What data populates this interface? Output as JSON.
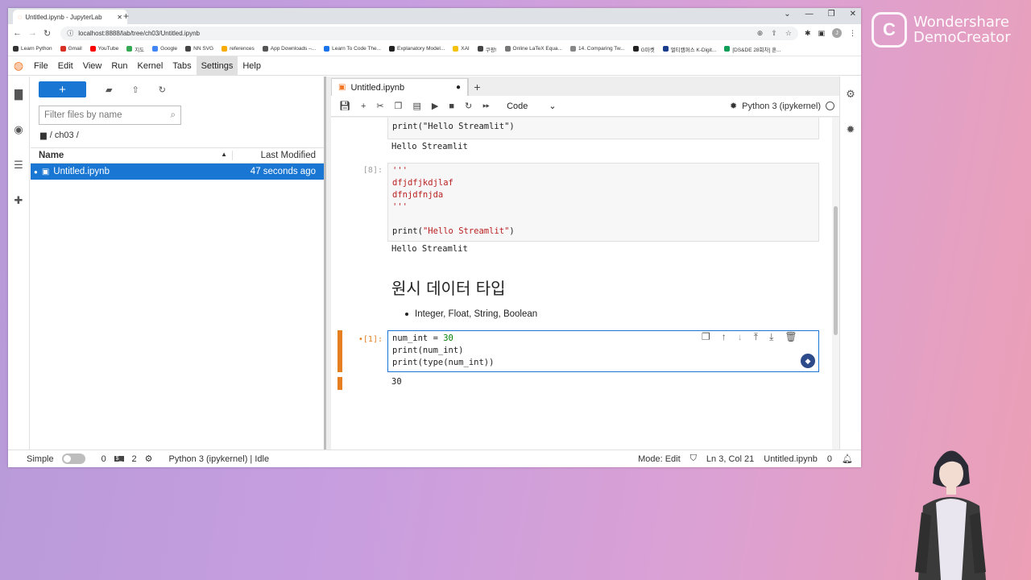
{
  "browser": {
    "tab_title": "Untitled.ipynb - JupyterLab",
    "url": "localhost:8888/lab/tree/ch03/Untitled.ipynb",
    "profile_initial": "J",
    "bookmarks": [
      {
        "label": "Learn Python",
        "color": "#333333"
      },
      {
        "label": "Gmail",
        "color": "#d93025"
      },
      {
        "label": "YouTube",
        "color": "#ff0000"
      },
      {
        "label": "지도",
        "color": "#34a853"
      },
      {
        "label": "Google",
        "color": "#4285f4"
      },
      {
        "label": "NN SVG",
        "color": "#444444"
      },
      {
        "label": "references",
        "color": "#f9ab00"
      },
      {
        "label": "App Downloads –...",
        "color": "#555555"
      },
      {
        "label": "Learn To Code The...",
        "color": "#1a73e8"
      },
      {
        "label": "Explanatory Model...",
        "color": "#222222"
      },
      {
        "label": "XAI",
        "color": "#f4c20d"
      },
      {
        "label": "쿠팡!",
        "color": "#444444"
      },
      {
        "label": "Online LaTeX Equa...",
        "color": "#777777"
      },
      {
        "label": "14. Comparing Tw...",
        "color": "#888888"
      },
      {
        "label": "G마켓",
        "color": "#222222"
      },
      {
        "label": "멀티캠퍼스 K-Digit...",
        "color": "#1a3e8c"
      },
      {
        "label": "[DS&DE 28회차] 혼...",
        "color": "#0f9d58"
      }
    ]
  },
  "jupyter": {
    "menu": [
      "File",
      "Edit",
      "View",
      "Run",
      "Kernel",
      "Tabs",
      "Settings",
      "Help"
    ],
    "active_menu": "Settings",
    "new_button": "+",
    "filter_placeholder": "Filter files by name",
    "breadcrumb": "/ ch03 /",
    "col_name": "Name",
    "col_modified": "Last Modified",
    "file": {
      "name": "Untitled.ipynb",
      "modified": "47 seconds ago"
    },
    "notebook_tab": "Untitled.ipynb",
    "cell_type": "Code",
    "kernel": "Python 3 (ipykernel)"
  },
  "cells": {
    "cell_a_input": "print(\"Hello Streamlit\")",
    "cell_a_output": "Hello Streamlit",
    "cell_b_prompt": "[8]:",
    "cell_b_line1": "'''",
    "cell_b_line2": "dfjdfjkdjlaf",
    "cell_b_line3": "dfnjdfnjda",
    "cell_b_line4": "'''",
    "cell_b_line5_fn": "print(",
    "cell_b_line5_str": "\"Hello Streamlit\"",
    "cell_b_line5_end": ")",
    "cell_b_output": "Hello Streamlit",
    "markdown_heading": "원시 데이터 타입",
    "markdown_bullet": "Integer, Float, String, Boolean",
    "cell_c_prompt": "•[1]:",
    "cell_c_line1_a": "num_int = ",
    "cell_c_line1_num": "30",
    "cell_c_line2": "print(num_int)",
    "cell_c_line3": "print(type(num_int))",
    "cell_c_output": "30"
  },
  "status": {
    "mode_label": "Simple",
    "count_a": "0",
    "count_b": "2",
    "kernel_status": "Python 3 (ipykernel) | Idle",
    "mode": "Mode: Edit",
    "cursor": "Ln 3, Col 21",
    "filename": "Untitled.ipynb",
    "notifications": "0"
  },
  "overlay": {
    "watermark_line1": "Wondershare",
    "watermark_line2": "DemoCreator"
  },
  "colors": {
    "accent": "#1976d2",
    "active_cell": "#e67e22",
    "string": "#ba2121",
    "number": "#008000"
  }
}
